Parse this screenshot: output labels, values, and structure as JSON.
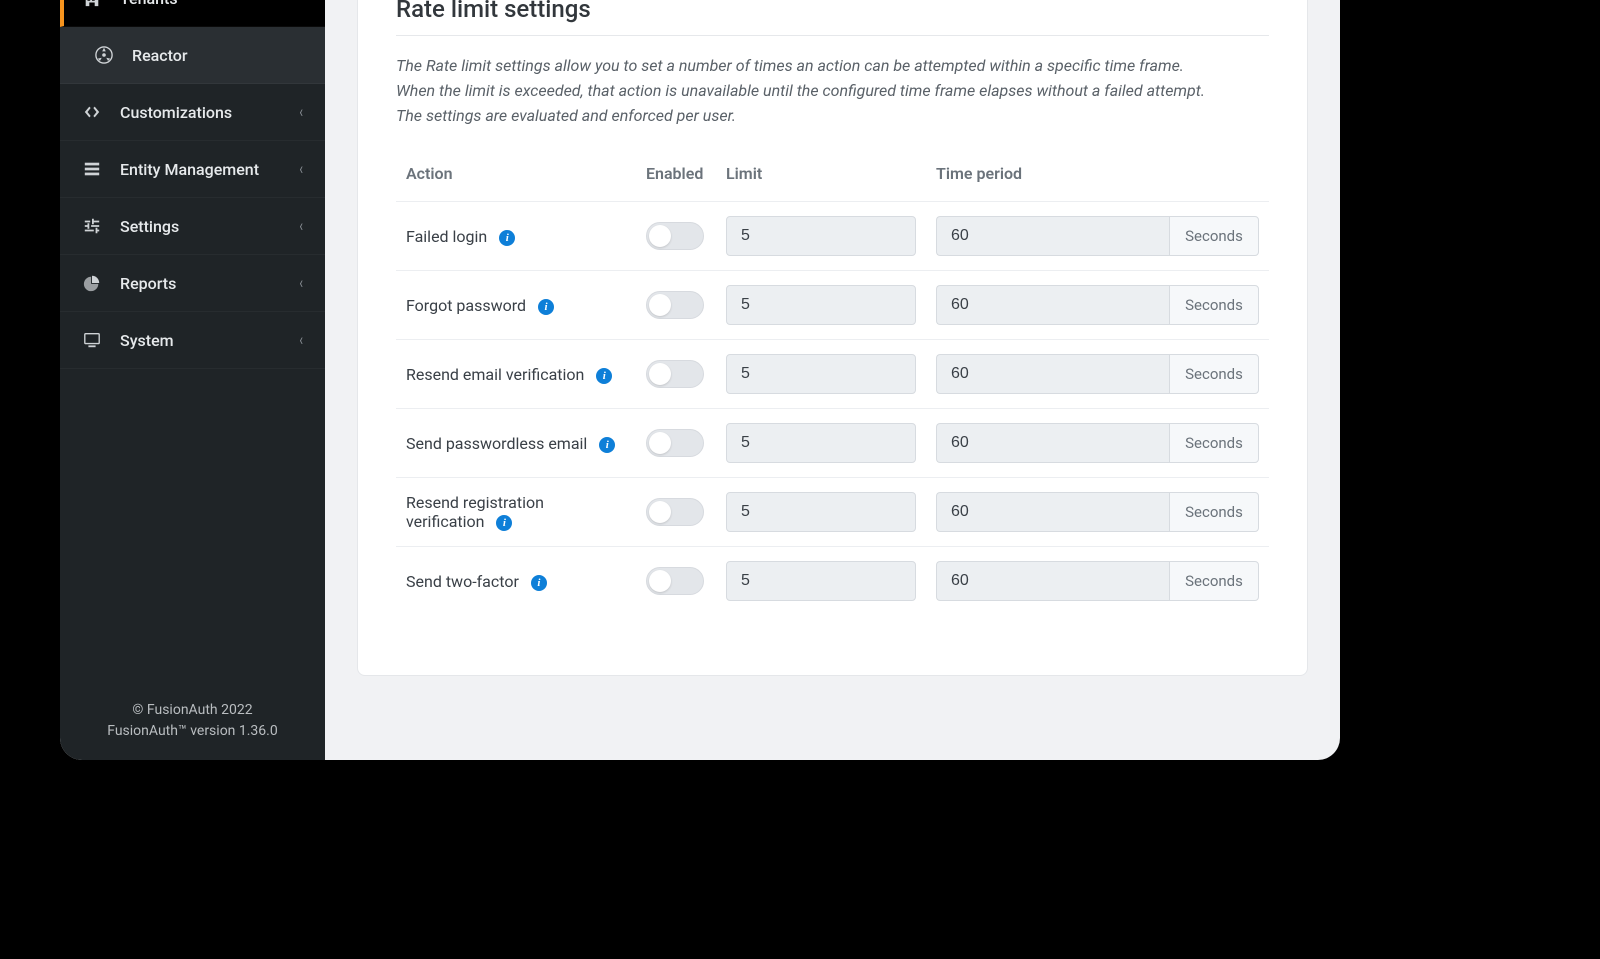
{
  "sidebar": {
    "items": [
      {
        "id": "tenants",
        "label": "Tenants",
        "icon": "building-icon",
        "active": true,
        "expandable": false
      },
      {
        "id": "reactor",
        "label": "Reactor",
        "icon": "reactor-icon",
        "sub": true,
        "expandable": false
      },
      {
        "id": "customizations",
        "label": "Customizations",
        "icon": "code-icon",
        "expandable": true
      },
      {
        "id": "entity-mgmt",
        "label": "Entity Management",
        "icon": "server-icon",
        "expandable": true
      },
      {
        "id": "settings",
        "label": "Settings",
        "icon": "sliders-icon",
        "expandable": true
      },
      {
        "id": "reports",
        "label": "Reports",
        "icon": "pie-chart-icon",
        "expandable": true
      },
      {
        "id": "system",
        "label": "System",
        "icon": "monitor-icon",
        "expandable": true
      }
    ],
    "footer": {
      "copyright": "© FusionAuth 2022",
      "version": "FusionAuth™ version 1.36.0"
    }
  },
  "panel": {
    "title": "Rate limit settings",
    "description": "The Rate limit settings allow you to set a number of times an action can be attempted within a specific time frame. When the limit is exceeded, that action is unavailable until the configured time frame elapses without a failed attempt. The settings are evaluated and enforced per user.",
    "columns": {
      "action": "Action",
      "enabled": "Enabled",
      "limit": "Limit",
      "period": "Time period"
    },
    "unit_label": "Seconds",
    "rows": [
      {
        "action": "Failed login",
        "enabled": false,
        "limit": "5",
        "period": "60"
      },
      {
        "action": "Forgot password",
        "enabled": false,
        "limit": "5",
        "period": "60"
      },
      {
        "action": "Resend email verification",
        "enabled": false,
        "limit": "5",
        "period": "60"
      },
      {
        "action": "Send passwordless email",
        "enabled": false,
        "limit": "5",
        "period": "60"
      },
      {
        "action": "Resend registration verification",
        "enabled": false,
        "limit": "5",
        "period": "60"
      },
      {
        "action": "Send two-factor",
        "enabled": false,
        "limit": "5",
        "period": "60"
      }
    ]
  }
}
